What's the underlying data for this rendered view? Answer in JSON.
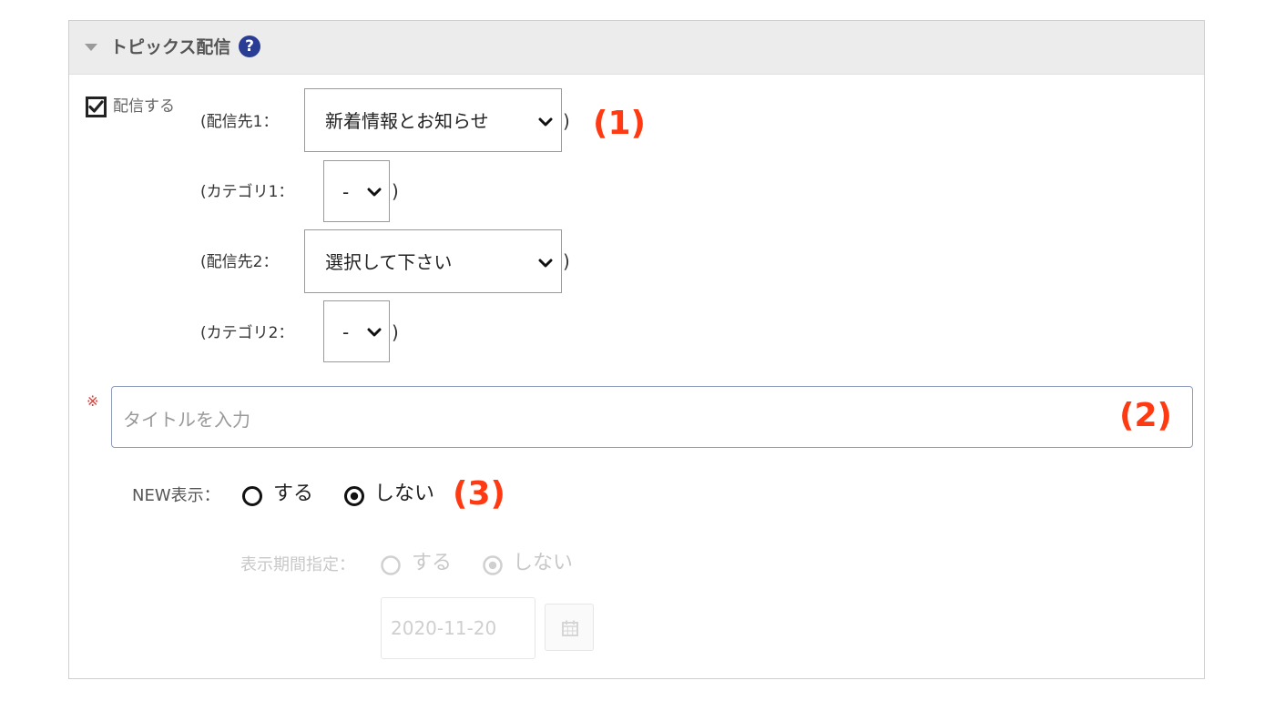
{
  "header": {
    "title": "トピックス配信",
    "help_icon": "?"
  },
  "distribute": {
    "checkbox_label": "配信する",
    "checked": true,
    "destination1_label": "(配信先1：",
    "destination1_value": "新着情報とお知らせ",
    "category1_label": "(カテゴリ1：",
    "category1_value": "-",
    "destination2_label": "(配信先2：",
    "destination2_value": "選択して下さい",
    "category2_label": "(カテゴリ2：",
    "category2_value": "-",
    "close_paren": ")"
  },
  "title_field": {
    "required_mark": "※",
    "placeholder": "タイトルを入力"
  },
  "new_display": {
    "label": "NEW表示：",
    "option_yes": "する",
    "option_no": "しない",
    "selected": "しない"
  },
  "period": {
    "label": "表示期間指定：",
    "option_yes": "する",
    "option_no": "しない",
    "selected": "しない",
    "date_value": "2020-11-20"
  },
  "annotations": {
    "a1": "(1)",
    "a2": "(2)",
    "a3": "(3)"
  },
  "colors": {
    "annotation": "#ff3a12",
    "help_icon_bg": "#2a3d94",
    "required": "#e53935"
  }
}
